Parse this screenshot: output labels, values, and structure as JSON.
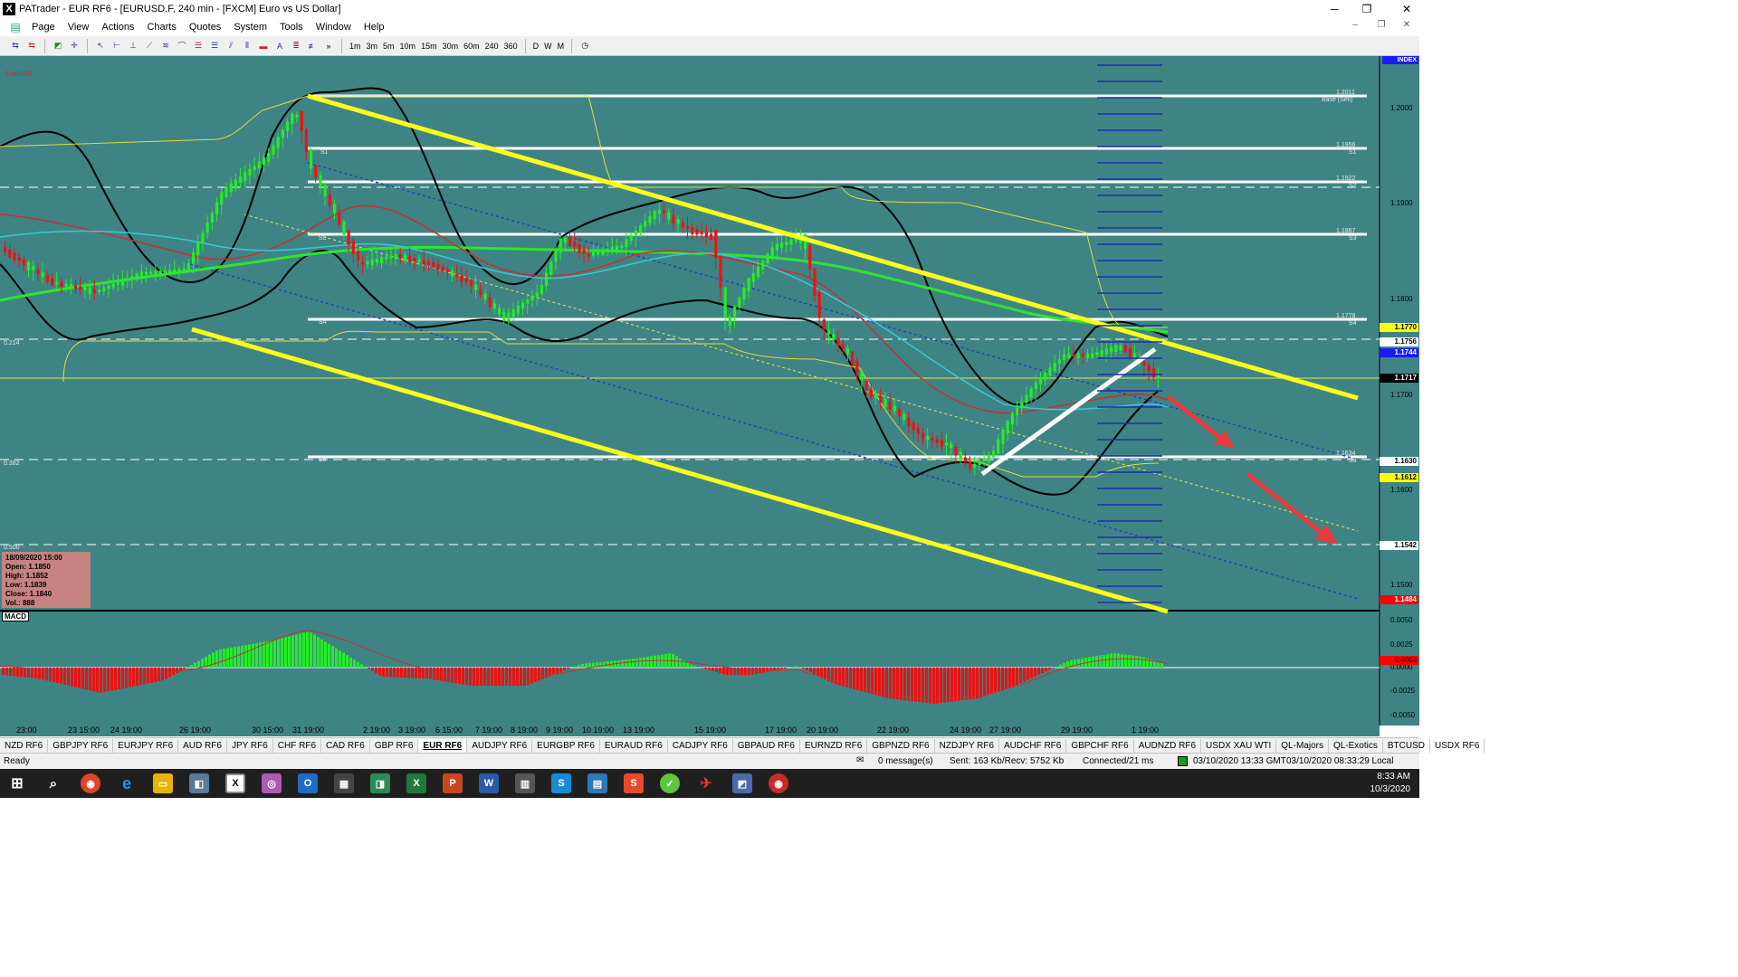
{
  "window": {
    "title": "PATrader - EUR RF6 - [EURUSD.F, 240 min - [FXCM] Euro vs US Dollar]",
    "app_icon": "X",
    "controls": [
      "─",
      "❐",
      "✕"
    ]
  },
  "menu": {
    "items": [
      "Page",
      "View",
      "Actions",
      "Charts",
      "Quotes",
      "System",
      "Tools",
      "Window",
      "Help"
    ],
    "mdi_controls": [
      "–",
      "❐",
      "✕"
    ]
  },
  "toolbar": {
    "timeframes": [
      "1m",
      "3m",
      "5m",
      "10m",
      "15m",
      "30m",
      "60m",
      "240",
      "360"
    ],
    "periods": [
      "D",
      "W",
      "M"
    ]
  },
  "chart": {
    "locked_label": "Locked",
    "index_label": "INDEX",
    "macd_label": "MACD",
    "fib_labels": [
      "0.214",
      "0.382",
      "0.500"
    ],
    "pivot_labels": [
      {
        "name": "S1",
        "value": "1.2011",
        "sub": "Base (Sell)"
      },
      {
        "name": "S1",
        "value": "1.1956",
        "sub": "S1"
      },
      {
        "name": "S2",
        "value": "1.1922",
        "sub": "S2"
      },
      {
        "name": "S3",
        "value": "1.1867",
        "sub": "S3"
      },
      {
        "name": "S4",
        "value": "1.1778",
        "sub": "S4"
      },
      {
        "name": "S5",
        "value": "1.1634",
        "sub": "S5"
      }
    ],
    "price_axis": [
      "1.2000",
      "1.1900",
      "1.1800",
      "1.1700",
      "1.1600",
      "1.1500"
    ],
    "price_tags": [
      {
        "value": "1.1770",
        "bg": "#ffff00",
        "fg": "#000000"
      },
      {
        "value": "1.1756",
        "bg": "#ffffff",
        "fg": "#000000"
      },
      {
        "value": "1.1744",
        "bg": "#1a1aff",
        "fg": "#ffffff"
      },
      {
        "value": "1.1717",
        "bg": "#000000",
        "fg": "#ffffff"
      },
      {
        "value": "1.1630",
        "bg": "#ffffff",
        "fg": "#000000"
      },
      {
        "value": "1.1612",
        "bg": "#ffff00",
        "fg": "#000000"
      },
      {
        "value": "1.1542",
        "bg": "#ffffff",
        "fg": "#000000"
      },
      {
        "value": "1.1484",
        "bg": "#ff0000",
        "fg": "#ffffff"
      }
    ],
    "macd_axis": [
      "0.0050",
      "0.0025",
      "0.0000",
      "-0.0025",
      "-0.0050"
    ],
    "macd_tag": {
      "value": "0.0003",
      "bg": "#ff0000"
    },
    "ohlc": {
      "date": "18/09/2020 15:00",
      "open": "Open: 1.1850",
      "high": "High: 1.1852",
      "low": "Low: 1.1839",
      "close": "Close: 1.1840",
      "vol": "Vol.: 888"
    },
    "time_axis": [
      "23:00",
      "23 15:00",
      "24 19:00",
      "26 19:00",
      "30 15:00",
      "31 19:00",
      "2 19:00",
      "3 19:00",
      "6 15:00",
      "7 19:00",
      "8 19:00",
      "9 19:00",
      "10 19:00",
      "13 19:00",
      "15 19:00",
      "17 19:00",
      "20 19:00",
      "22 19:00",
      "24 19:00",
      "27 19:00",
      "29 19:00",
      "1 19:00"
    ],
    "colors": {
      "background": "#3f8484",
      "trendline": "#ffff00",
      "bull": "#22ee22",
      "bear": "#ee1111"
    }
  },
  "symbol_tabs": [
    "NZD RF6",
    "GBPJPY RF6",
    "EURJPY RF6",
    "AUD RF6",
    "JPY RF6",
    "CHF RF6",
    "CAD RF6",
    "GBP RF6",
    "EUR RF6",
    "AUDJPY RF6",
    "EURGBP RF6",
    "EURAUD RF6",
    "CADJPY RF6",
    "GBPAUD RF6",
    "EURNZD RF6",
    "GBPNZD RF6",
    "NZDJPY RF6",
    "AUDCHF RF6",
    "GBPCHF RF6",
    "AUDNZD RF6",
    "USDX XAU WTI",
    "QL-Majors",
    "QL-Exotics",
    "BTCUSD",
    "USDX RF6"
  ],
  "active_tab": "EUR RF6",
  "status": {
    "ready": "Ready",
    "messages": "0 message(s)",
    "traffic": "Sent: 163 Kb/Recv: 5752 Kb",
    "connection": "Connected/21 ms",
    "gmt": "03/10/2020 13:33 GMT",
    "local": "03/10/2020 08:33:29 Local"
  },
  "taskbar": {
    "time": "8:33 AM",
    "date": "10/3/2020"
  }
}
